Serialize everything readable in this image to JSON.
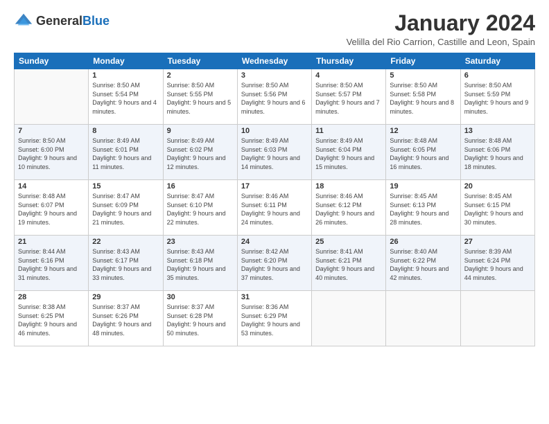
{
  "logo": {
    "general": "General",
    "blue": "Blue"
  },
  "title": "January 2024",
  "location": "Velilla del Rio Carrion, Castille and Leon, Spain",
  "weekdays": [
    "Sunday",
    "Monday",
    "Tuesday",
    "Wednesday",
    "Thursday",
    "Friday",
    "Saturday"
  ],
  "weeks": [
    [
      {
        "day": "",
        "sunrise": "",
        "sunset": "",
        "daylight": ""
      },
      {
        "day": "1",
        "sunrise": "Sunrise: 8:50 AM",
        "sunset": "Sunset: 5:54 PM",
        "daylight": "Daylight: 9 hours and 4 minutes."
      },
      {
        "day": "2",
        "sunrise": "Sunrise: 8:50 AM",
        "sunset": "Sunset: 5:55 PM",
        "daylight": "Daylight: 9 hours and 5 minutes."
      },
      {
        "day": "3",
        "sunrise": "Sunrise: 8:50 AM",
        "sunset": "Sunset: 5:56 PM",
        "daylight": "Daylight: 9 hours and 6 minutes."
      },
      {
        "day": "4",
        "sunrise": "Sunrise: 8:50 AM",
        "sunset": "Sunset: 5:57 PM",
        "daylight": "Daylight: 9 hours and 7 minutes."
      },
      {
        "day": "5",
        "sunrise": "Sunrise: 8:50 AM",
        "sunset": "Sunset: 5:58 PM",
        "daylight": "Daylight: 9 hours and 8 minutes."
      },
      {
        "day": "6",
        "sunrise": "Sunrise: 8:50 AM",
        "sunset": "Sunset: 5:59 PM",
        "daylight": "Daylight: 9 hours and 9 minutes."
      }
    ],
    [
      {
        "day": "7",
        "sunrise": "Sunrise: 8:50 AM",
        "sunset": "Sunset: 6:00 PM",
        "daylight": "Daylight: 9 hours and 10 minutes."
      },
      {
        "day": "8",
        "sunrise": "Sunrise: 8:49 AM",
        "sunset": "Sunset: 6:01 PM",
        "daylight": "Daylight: 9 hours and 11 minutes."
      },
      {
        "day": "9",
        "sunrise": "Sunrise: 8:49 AM",
        "sunset": "Sunset: 6:02 PM",
        "daylight": "Daylight: 9 hours and 12 minutes."
      },
      {
        "day": "10",
        "sunrise": "Sunrise: 8:49 AM",
        "sunset": "Sunset: 6:03 PM",
        "daylight": "Daylight: 9 hours and 14 minutes."
      },
      {
        "day": "11",
        "sunrise": "Sunrise: 8:49 AM",
        "sunset": "Sunset: 6:04 PM",
        "daylight": "Daylight: 9 hours and 15 minutes."
      },
      {
        "day": "12",
        "sunrise": "Sunrise: 8:48 AM",
        "sunset": "Sunset: 6:05 PM",
        "daylight": "Daylight: 9 hours and 16 minutes."
      },
      {
        "day": "13",
        "sunrise": "Sunrise: 8:48 AM",
        "sunset": "Sunset: 6:06 PM",
        "daylight": "Daylight: 9 hours and 18 minutes."
      }
    ],
    [
      {
        "day": "14",
        "sunrise": "Sunrise: 8:48 AM",
        "sunset": "Sunset: 6:07 PM",
        "daylight": "Daylight: 9 hours and 19 minutes."
      },
      {
        "day": "15",
        "sunrise": "Sunrise: 8:47 AM",
        "sunset": "Sunset: 6:09 PM",
        "daylight": "Daylight: 9 hours and 21 minutes."
      },
      {
        "day": "16",
        "sunrise": "Sunrise: 8:47 AM",
        "sunset": "Sunset: 6:10 PM",
        "daylight": "Daylight: 9 hours and 22 minutes."
      },
      {
        "day": "17",
        "sunrise": "Sunrise: 8:46 AM",
        "sunset": "Sunset: 6:11 PM",
        "daylight": "Daylight: 9 hours and 24 minutes."
      },
      {
        "day": "18",
        "sunrise": "Sunrise: 8:46 AM",
        "sunset": "Sunset: 6:12 PM",
        "daylight": "Daylight: 9 hours and 26 minutes."
      },
      {
        "day": "19",
        "sunrise": "Sunrise: 8:45 AM",
        "sunset": "Sunset: 6:13 PM",
        "daylight": "Daylight: 9 hours and 28 minutes."
      },
      {
        "day": "20",
        "sunrise": "Sunrise: 8:45 AM",
        "sunset": "Sunset: 6:15 PM",
        "daylight": "Daylight: 9 hours and 30 minutes."
      }
    ],
    [
      {
        "day": "21",
        "sunrise": "Sunrise: 8:44 AM",
        "sunset": "Sunset: 6:16 PM",
        "daylight": "Daylight: 9 hours and 31 minutes."
      },
      {
        "day": "22",
        "sunrise": "Sunrise: 8:43 AM",
        "sunset": "Sunset: 6:17 PM",
        "daylight": "Daylight: 9 hours and 33 minutes."
      },
      {
        "day": "23",
        "sunrise": "Sunrise: 8:43 AM",
        "sunset": "Sunset: 6:18 PM",
        "daylight": "Daylight: 9 hours and 35 minutes."
      },
      {
        "day": "24",
        "sunrise": "Sunrise: 8:42 AM",
        "sunset": "Sunset: 6:20 PM",
        "daylight": "Daylight: 9 hours and 37 minutes."
      },
      {
        "day": "25",
        "sunrise": "Sunrise: 8:41 AM",
        "sunset": "Sunset: 6:21 PM",
        "daylight": "Daylight: 9 hours and 40 minutes."
      },
      {
        "day": "26",
        "sunrise": "Sunrise: 8:40 AM",
        "sunset": "Sunset: 6:22 PM",
        "daylight": "Daylight: 9 hours and 42 minutes."
      },
      {
        "day": "27",
        "sunrise": "Sunrise: 8:39 AM",
        "sunset": "Sunset: 6:24 PM",
        "daylight": "Daylight: 9 hours and 44 minutes."
      }
    ],
    [
      {
        "day": "28",
        "sunrise": "Sunrise: 8:38 AM",
        "sunset": "Sunset: 6:25 PM",
        "daylight": "Daylight: 9 hours and 46 minutes."
      },
      {
        "day": "29",
        "sunrise": "Sunrise: 8:37 AM",
        "sunset": "Sunset: 6:26 PM",
        "daylight": "Daylight: 9 hours and 48 minutes."
      },
      {
        "day": "30",
        "sunrise": "Sunrise: 8:37 AM",
        "sunset": "Sunset: 6:28 PM",
        "daylight": "Daylight: 9 hours and 50 minutes."
      },
      {
        "day": "31",
        "sunrise": "Sunrise: 8:36 AM",
        "sunset": "Sunset: 6:29 PM",
        "daylight": "Daylight: 9 hours and 53 minutes."
      },
      {
        "day": "",
        "sunrise": "",
        "sunset": "",
        "daylight": ""
      },
      {
        "day": "",
        "sunrise": "",
        "sunset": "",
        "daylight": ""
      },
      {
        "day": "",
        "sunrise": "",
        "sunset": "",
        "daylight": ""
      }
    ]
  ]
}
